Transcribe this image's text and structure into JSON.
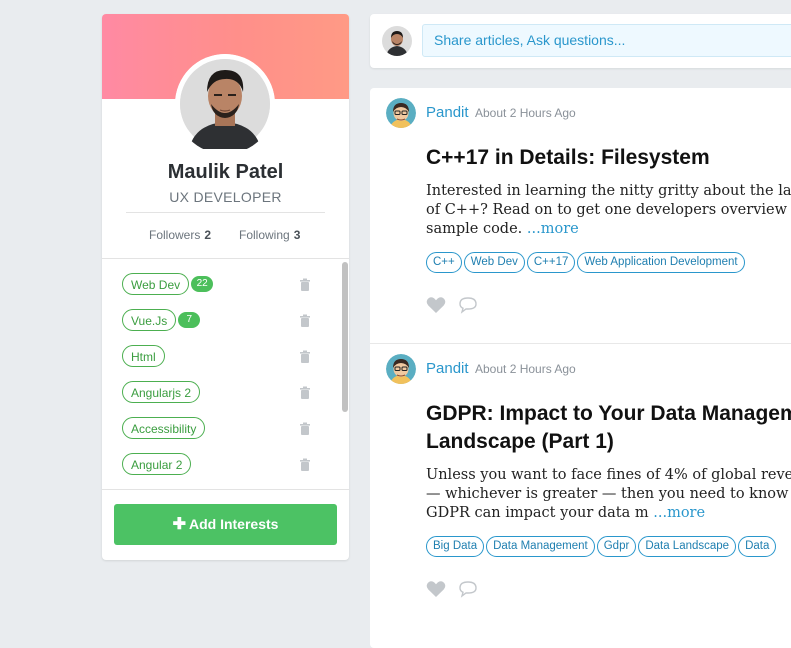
{
  "profile": {
    "name": "Maulik Patel",
    "role": "UX DEVELOPER",
    "followers_label": "Followers",
    "followers_count": "2",
    "following_label": "Following",
    "following_count": "3"
  },
  "interests": [
    {
      "label": "Web Dev",
      "count": "22"
    },
    {
      "label": "Vue.Js",
      "count": "7"
    },
    {
      "label": "Html",
      "count": ""
    },
    {
      "label": "Angularjs 2",
      "count": ""
    },
    {
      "label": "Accessibility",
      "count": ""
    },
    {
      "label": "Angular 2",
      "count": ""
    }
  ],
  "add_interests_label": "Add Interests",
  "composer": {
    "placeholder": "Share articles, Ask questions..."
  },
  "posts": [
    {
      "author": "Pandit",
      "time": "About 2 Hours Ago",
      "title_lines": [
        "C++17 in Details: Filesystem"
      ],
      "excerpt_lines": [
        "Interested in learning the nitty gritty about the la",
        "of C++? Read on to get one developers overview a",
        "sample code."
      ],
      "more_label": "...more",
      "tags": [
        "C++",
        "Web Dev",
        "C++17",
        "Web Application Development"
      ]
    },
    {
      "author": "Pandit",
      "time": "About 2 Hours Ago",
      "title_lines": [
        "GDPR: Impact to Your Data Managem",
        "Landscape (Part 1)"
      ],
      "excerpt_lines": [
        "Unless you want to face fines of 4% of global reve",
        "— whichever is greater — then you need to know",
        "GDPR can impact your data m"
      ],
      "more_label": "...more",
      "tags": [
        "Big Data",
        "Data Management",
        "Gdpr",
        "Data Landscape",
        "Data"
      ]
    }
  ],
  "icons": {
    "delete": "trash-icon",
    "like": "heart-icon",
    "comment": "speech-bubble-icon",
    "add": "plus-icon"
  },
  "colors": {
    "accent_blue": "#2a97cc",
    "accent_green": "#4cc264",
    "banner": "#ff8f8a"
  }
}
